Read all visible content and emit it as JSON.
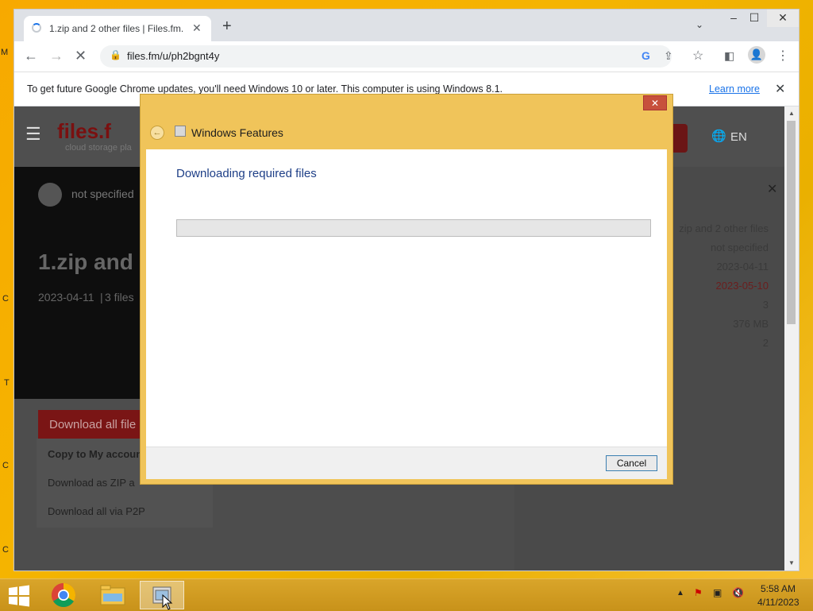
{
  "desktop": {
    "edge_letters": [
      "M",
      "C",
      "T",
      "C",
      "C"
    ]
  },
  "browser": {
    "tab": {
      "title": "1.zip and 2 other files | Files.fm."
    },
    "url": "files.fm/u/ph2bgnt4y",
    "infobar": {
      "message": "To get future Google Chrome updates, you'll need Windows 10 or later. This computer is using Windows 8.1.",
      "link": "Learn more"
    }
  },
  "page": {
    "logo": "files.f",
    "logo_sub": "cloud storage pla",
    "language": "EN",
    "uploader": "not specified",
    "big_title": "1.zip and",
    "meta_date": "2023-04-11",
    "meta_files": "3 files",
    "download_btn": "Download all file",
    "menu": [
      "Copy to My accoun",
      "Download as ZIP a",
      "Download all via P2P"
    ],
    "side_info": [
      "zip and 2 other files",
      "not specified",
      "2023-04-11",
      "2023-05-10",
      "3",
      "376 MB",
      "2"
    ]
  },
  "dialog": {
    "title": "Windows Features",
    "heading": "Downloading required files",
    "progress": 0,
    "cancel": "Cancel"
  },
  "taskbar": {
    "time": "5:58 AM",
    "date": "4/11/2023"
  }
}
